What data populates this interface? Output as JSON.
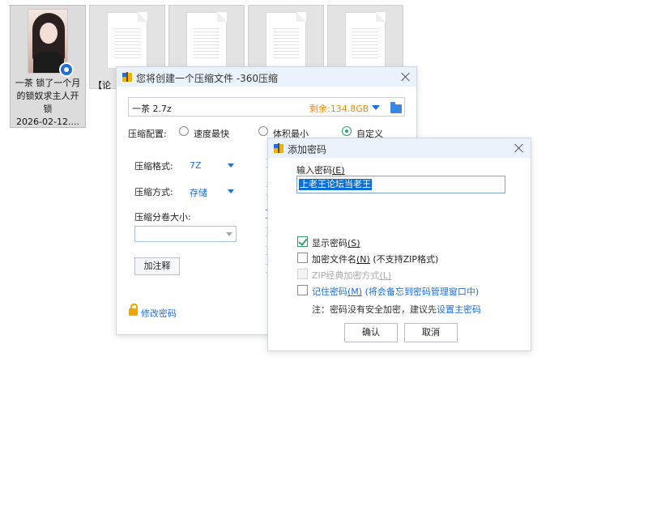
{
  "desktop": {
    "files": [
      {
        "type": "video",
        "caption_lines": [
          "一茶 锁了一个月",
          "的锁奴求主人开",
          "锁",
          "2026-02-12...."
        ]
      },
      {
        "type": "document",
        "caption": "【论"
      },
      {
        "type": "document",
        "caption": ""
      },
      {
        "type": "document",
        "caption": ""
      },
      {
        "type": "document",
        "caption": ""
      }
    ]
  },
  "compress_dialog": {
    "title": "您将创建一个压缩文件 -360压缩",
    "archive_name": "一茶 2.7z",
    "free_space": "剩余:134.8GB",
    "config_label": "压缩配置:",
    "options": [
      "速度最快",
      "体积最小",
      "自定义"
    ],
    "selected_option": "自定义",
    "format_label": "压缩格式:",
    "format_value": "7Z",
    "method_label": "压缩方式:",
    "method_value": "存储",
    "volume_label": "压缩分卷大小:",
    "volume_value": "",
    "add_comment_button": "加注释",
    "change_password_link": "修改密码"
  },
  "password_dialog": {
    "title": "添加密码",
    "input_label": "输入密码",
    "input_label_key": "(E)",
    "password_value": "上老王论坛当老王",
    "show_password": {
      "label": "显示密码",
      "key": "(S)",
      "checked": true
    },
    "encrypt_filenames": {
      "label": "加密文件名",
      "key": "(N)",
      "note": "(不支持ZIP格式)",
      "checked": false
    },
    "zip_classic": {
      "label": "ZIP经典加密方式",
      "key": "(L)",
      "checked": false,
      "disabled": true
    },
    "remember": {
      "label": "记住密码",
      "key": "(M)",
      "note": "(将会备忘到密码管理窗口中)",
      "checked": false
    },
    "note_text": "注：密码没有安全加密，建议先",
    "note_link": "设置主密码",
    "ok_button": "确认",
    "cancel_button": "取消"
  },
  "colors": {
    "accent": "#1f6fe0",
    "warning": "#f08a00",
    "check": "#2aa26a",
    "title_bar": "#eaf2fb"
  }
}
